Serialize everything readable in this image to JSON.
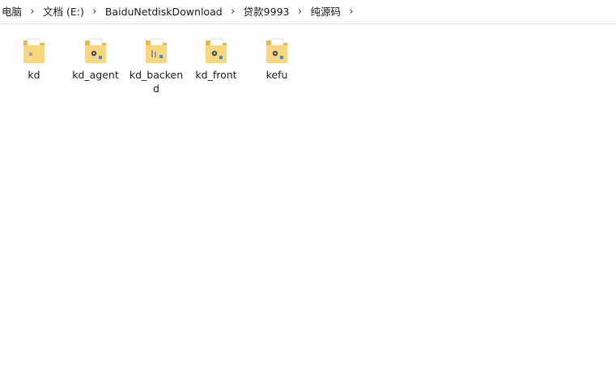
{
  "breadcrumb": {
    "items": [
      "电脑",
      "文档 (E:)",
      "BaiduNetdiskDownload",
      "贷款9993",
      "纯源码"
    ]
  },
  "folders": [
    {
      "name": "kd",
      "icon": "folder-document-icon"
    },
    {
      "name": "kd_agent",
      "icon": "folder-settings-icon"
    },
    {
      "name": "kd_backend",
      "icon": "folder-files-icon"
    },
    {
      "name": "kd_front",
      "icon": "folder-settings-icon"
    },
    {
      "name": "kefu",
      "icon": "folder-settings-icon"
    }
  ],
  "colors": {
    "folder_front": "#f9d77e",
    "folder_back": "#e8b94a",
    "paper": "#ffffff",
    "accent": "#3a8fd6"
  }
}
